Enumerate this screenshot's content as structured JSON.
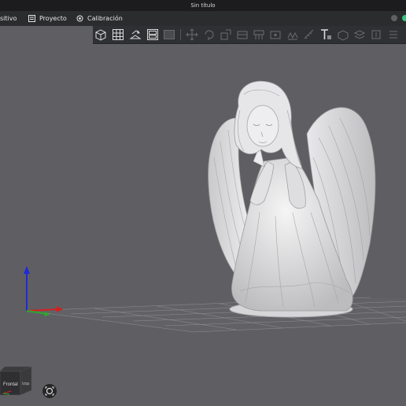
{
  "window": {
    "title": "Sin título"
  },
  "menu": {
    "device_label": "sitivo",
    "project_label": "Proyecto",
    "calibration_label": "Calibración"
  },
  "navcube": {
    "front_label": "Frontal",
    "side_label": "Izqu"
  },
  "colors": {
    "background": "#5f5f63",
    "accent_green": "#37c37c",
    "axis_z": "#1f2ad8",
    "axis_x": "#d42020",
    "axis_y": "#2ea82e"
  },
  "icons": {
    "toolbar": [
      "add-cube-icon",
      "grid-arrange-icon",
      "auto-orient-icon",
      "split-plates-icon",
      "plate-icon",
      "move-icon",
      "rotate-icon",
      "scale-icon",
      "cut-icon",
      "support-icon",
      "seam-icon",
      "fuzzy-skin-icon",
      "measure-icon",
      "text-icon",
      "assembly-icon",
      "layer-icon",
      "variable-height-icon",
      "object-list-icon"
    ]
  }
}
